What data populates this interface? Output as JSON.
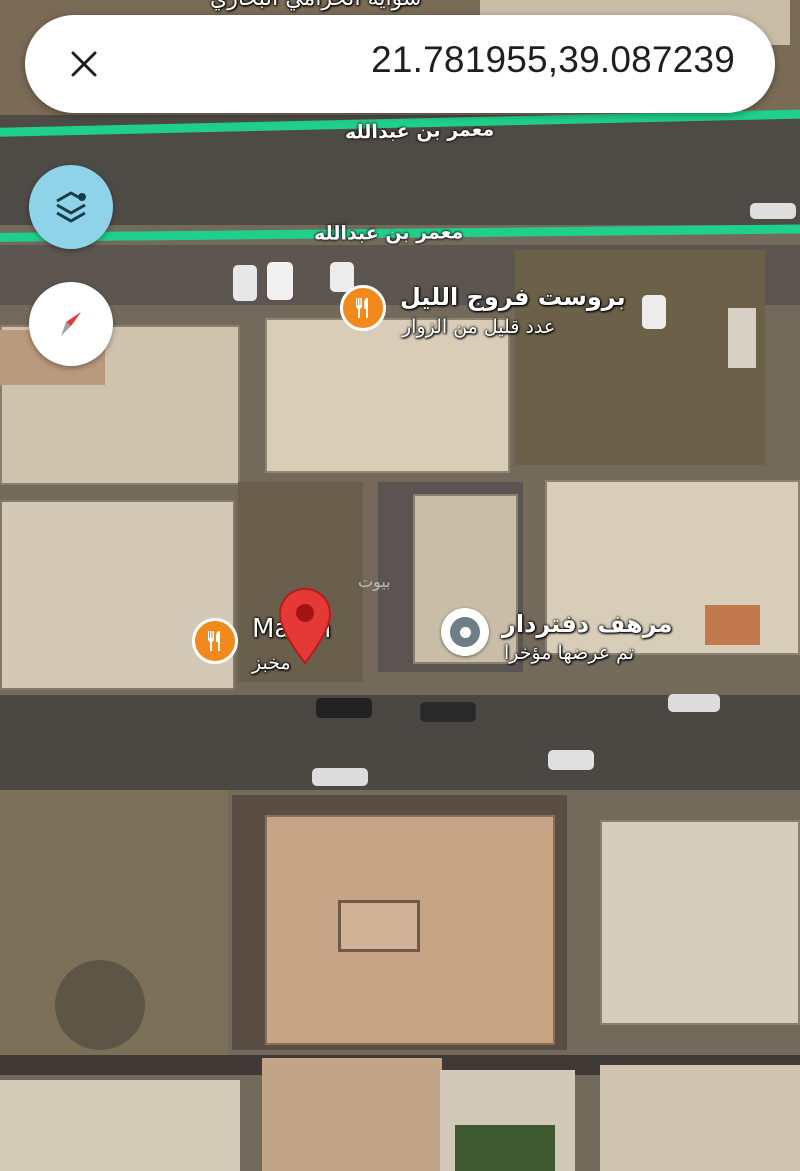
{
  "search": {
    "coordinates": "21.781955,39.087239"
  },
  "colors": {
    "road_line": "#1fd08a",
    "poi_food": "#f2891c",
    "layers_button": "#8fd3e8",
    "pin": "#e53935"
  },
  "streets": {
    "upper": "معمر بن عبدالله",
    "lower": "معمر بن عبدالله"
  },
  "places": {
    "top_partial": "شوايه الحرامي البخاري",
    "restaurant": {
      "name": "بروست فروج الليل",
      "subtitle": "عدد قليل من الزوار"
    },
    "bakery": {
      "name": "Ma  ah",
      "subtitle": "مخبز"
    },
    "shop": {
      "name": "مرهف دفتردار",
      "subtitle": "تم عرضها مؤخرا"
    }
  },
  "watermark": "بيوت",
  "icons": {
    "close": "close-icon",
    "layers": "layers-icon",
    "compass": "compass-icon",
    "fork_knife": "fork-knife-icon",
    "pin": "location-pin-icon"
  }
}
